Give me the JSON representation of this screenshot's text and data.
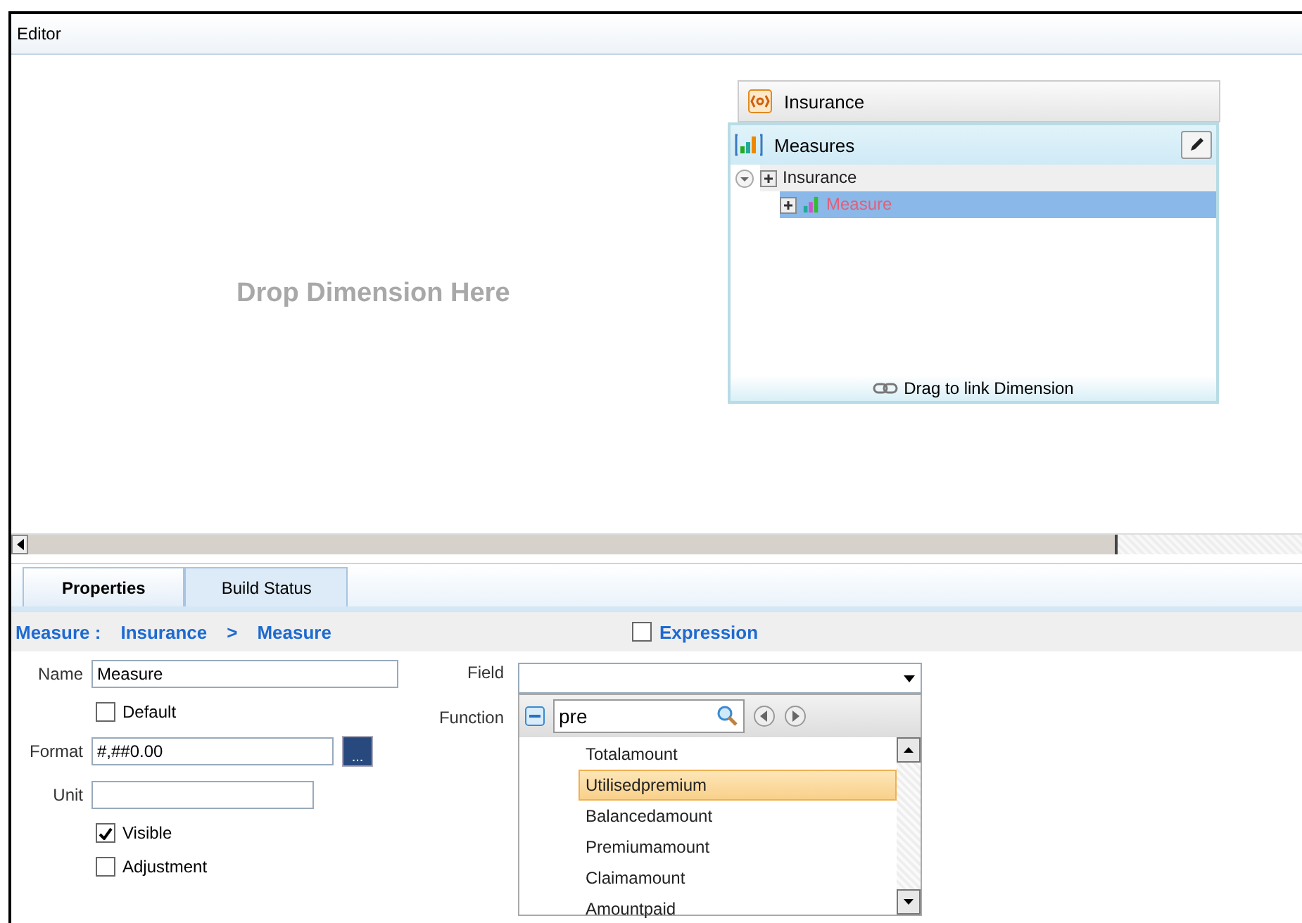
{
  "editor": {
    "title": "Editor",
    "placeholder_text": "Drop Dimension Here"
  },
  "cube": {
    "title": "Insurance",
    "panel_title": "Measures",
    "tree": [
      {
        "label": "Insurance",
        "expanded": true,
        "selected": false,
        "children": [
          {
            "label": "Measure",
            "selected": true
          }
        ]
      }
    ],
    "footer": "Drag to link Dimension"
  },
  "tabs": [
    {
      "label": "Properties",
      "selected": true
    },
    {
      "label": "Build Status",
      "selected": false
    }
  ],
  "breadcrumb": [
    "Measure :",
    "Insurance",
    ">",
    "Measure"
  ],
  "expression": {
    "label": "Expression",
    "checked": false
  },
  "form": {
    "name": {
      "label": "Name",
      "value": "Measure"
    },
    "default": {
      "label": "Default",
      "checked": false
    },
    "format": {
      "label": "Format",
      "value": "#,##0.00",
      "button": "..."
    },
    "unit": {
      "label": "Unit"
    },
    "visible": {
      "label": "Visible",
      "checked": true
    },
    "adjustment": {
      "label": "Adjustment",
      "checked": false
    }
  },
  "field": {
    "label": "Field"
  },
  "function": {
    "label": "Function",
    "search": "pre",
    "items": [
      {
        "label": "Totalamount",
        "selected": false
      },
      {
        "label": "Utilisedpremium",
        "selected": true
      },
      {
        "label": "Balancedamount",
        "selected": false
      },
      {
        "label": "Premiumamount",
        "selected": false
      },
      {
        "label": "Claimamount",
        "selected": false
      },
      {
        "label": "Amountpaid",
        "selected": false
      }
    ]
  }
}
